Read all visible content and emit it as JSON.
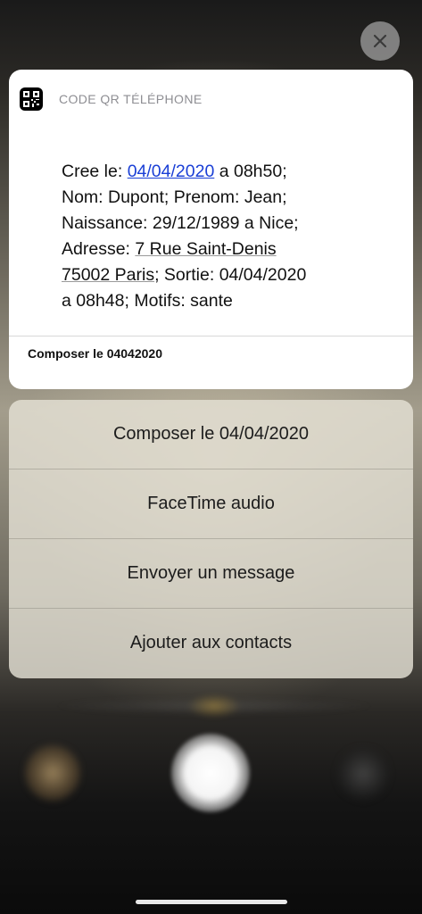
{
  "notification": {
    "app_name": "CODE QR TÉLÉPHONE",
    "app_icon": "qr-code-icon",
    "body": {
      "line1_prefix": "Cree le: ",
      "created_date": "04/04/2020",
      "line1_suffix": " a 08h50;",
      "line2": "Nom: Dupont; Prenom: Jean;",
      "line3": "Naissance: 29/12/1989 a Nice;",
      "line4_prefix": "Adresse: ",
      "address_part1": "7 Rue Saint-Denis",
      "address_part2": "75002 Paris",
      "line5_suffix": "; Sortie: 04/04/2020",
      "line6": "a 08h48; Motifs: sante"
    },
    "footer_action": "Composer le 04042020"
  },
  "menu": {
    "items": [
      {
        "label": "Composer le 04/04/2020"
      },
      {
        "label": "FaceTime audio"
      },
      {
        "label": "Envoyer un message"
      },
      {
        "label": "Ajouter aux contacts"
      }
    ]
  },
  "close_icon": "close-icon",
  "colors": {
    "link": "#1a3fd6",
    "card_bg": "#ffffff",
    "menu_bg": "#e4e0d4",
    "app_name": "#8e8e93"
  }
}
